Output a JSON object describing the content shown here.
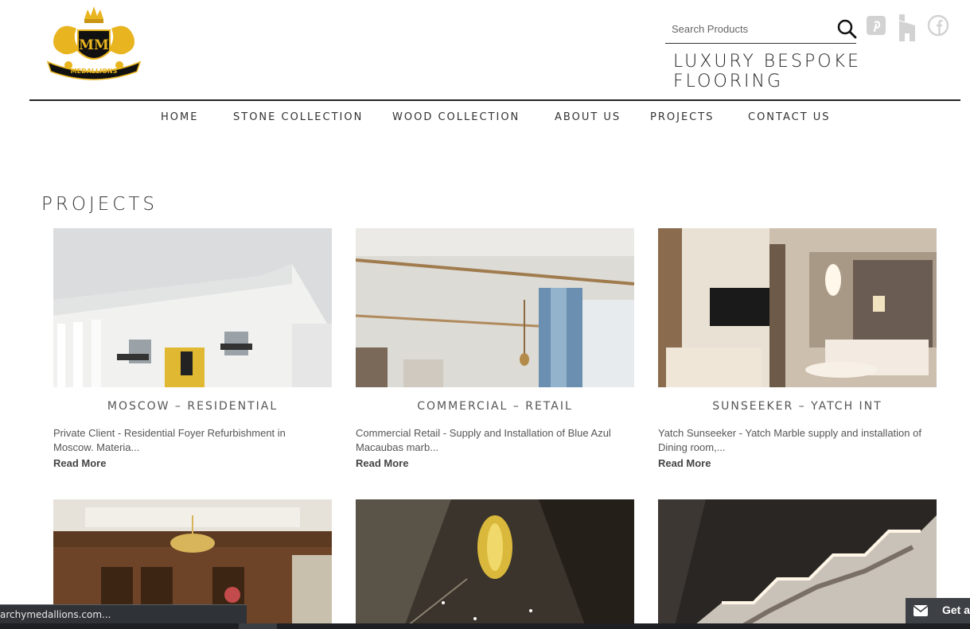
{
  "header": {
    "logo_text": "MM",
    "logo_banner": "MEDALLIONS",
    "logo_arc": "MONARCHY",
    "search": {
      "placeholder": "Search Products"
    },
    "tagline": "LUXURY BESPOKE FLOORING",
    "social_icons": [
      "pinterest-icon",
      "houzz-icon",
      "facebook-icon"
    ]
  },
  "nav": {
    "items": [
      {
        "label": "HOME"
      },
      {
        "label": "STONE COLLECTION"
      },
      {
        "label": "WOOD COLLECTION"
      },
      {
        "label": "ABOUT US"
      },
      {
        "label": "PROJECTS"
      },
      {
        "label": "CONTACT US"
      }
    ]
  },
  "main": {
    "title": "PROJECTS",
    "projects": [
      {
        "title": "MOSCOW – RESIDENTIAL",
        "description": "Private Client - Residential Foyer Refurbishment in Moscow. Materia...",
        "read_more": "Read More"
      },
      {
        "title": "COMMERCIAL – RETAIL",
        "description": "Commercial Retail - Supply and Installation of Blue Azul Macaubas marb...",
        "read_more": "Read More"
      },
      {
        "title": "SUNSEEKER – YATCH INT",
        "description": "Yatch Sunseeker - Yatch Marble supply and installation of Dining room,...",
        "read_more": "Read More"
      }
    ]
  },
  "status_bar": {
    "url": "archymedallions.com..."
  },
  "chat": {
    "label": "Get a"
  },
  "colors": {
    "gold": "#e8b41f",
    "dark": "#222222",
    "social_grey": "#cfcfcf"
  }
}
